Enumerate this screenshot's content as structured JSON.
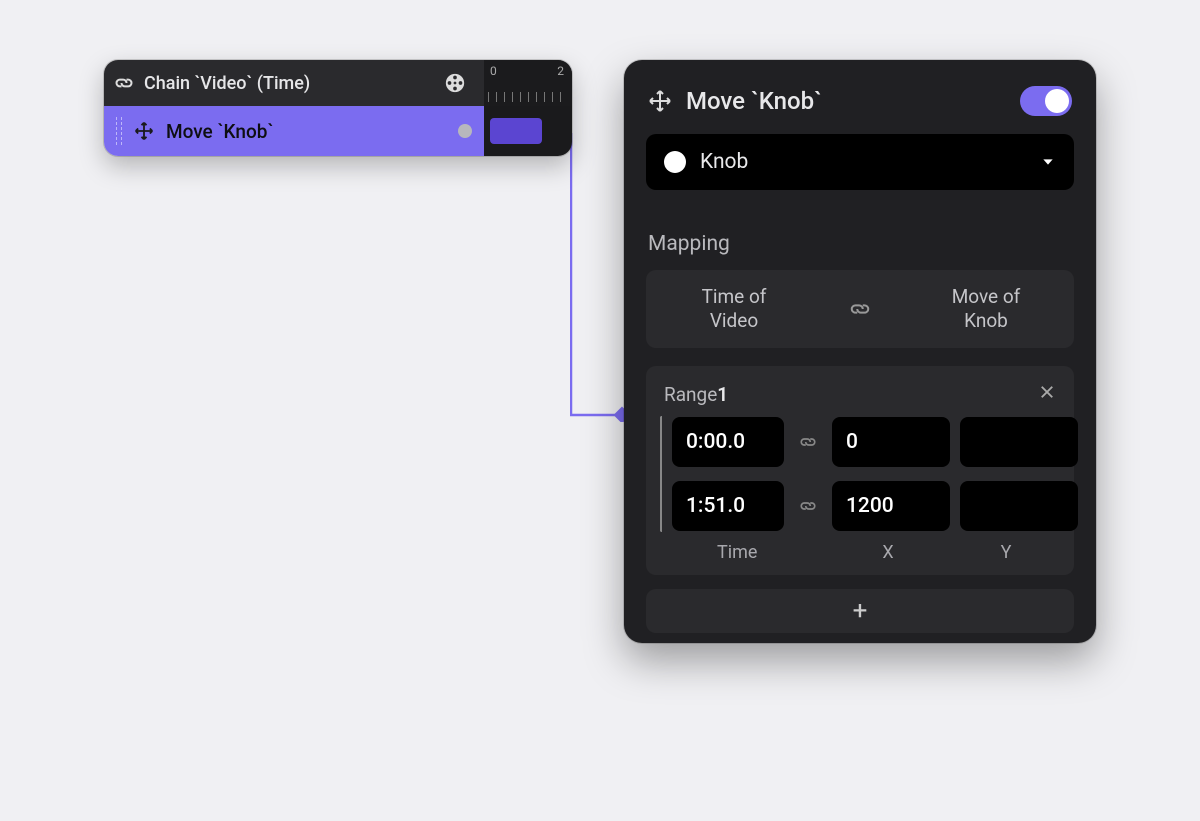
{
  "node": {
    "header_title": "Chain `Video` (Time)",
    "ruler": {
      "tick0": "0",
      "tick2": "2"
    },
    "row": {
      "title": "Move `Knob`"
    }
  },
  "inspector": {
    "title": "Move `Knob`",
    "enabled": true,
    "target": {
      "label": "Knob"
    },
    "mapping": {
      "section_label": "Mapping",
      "left_line1": "Time of",
      "left_line2": "Video",
      "right_line1": "Move of",
      "right_line2": "Knob"
    },
    "range": {
      "label": "Range",
      "index": "1",
      "rows": [
        {
          "time": "0:00.0",
          "x": "0",
          "y": ""
        },
        {
          "time": "1:51.0",
          "x": "1200",
          "y": ""
        }
      ],
      "col_time": "Time",
      "col_x": "X",
      "col_y": "Y"
    },
    "add_label": "+"
  }
}
